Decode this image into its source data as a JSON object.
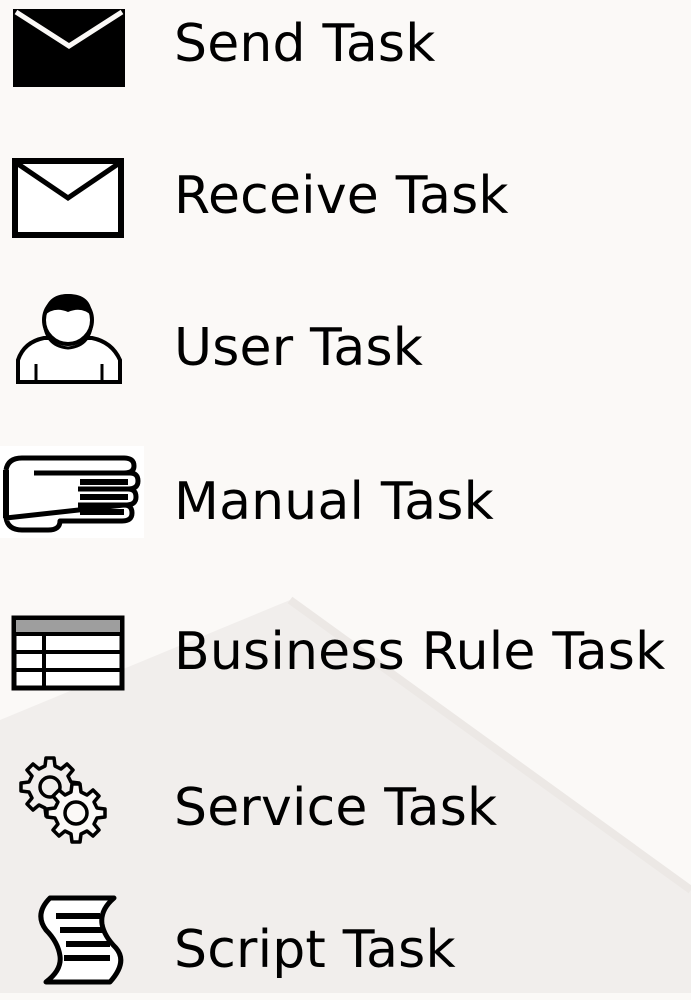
{
  "background_color": "#fbf9f7",
  "text_color": "#000000",
  "items": [
    {
      "label": "Send Task",
      "icon": "send-envelope-icon"
    },
    {
      "label": "Receive Task",
      "icon": "receive-envelope-icon"
    },
    {
      "label": "User Task",
      "icon": "user-icon"
    },
    {
      "label": "Manual Task",
      "icon": "hand-icon"
    },
    {
      "label": "Business Rule Task",
      "icon": "table-icon"
    },
    {
      "label": "Service Task",
      "icon": "gears-icon"
    },
    {
      "label": "Script Task",
      "icon": "script-icon"
    }
  ]
}
